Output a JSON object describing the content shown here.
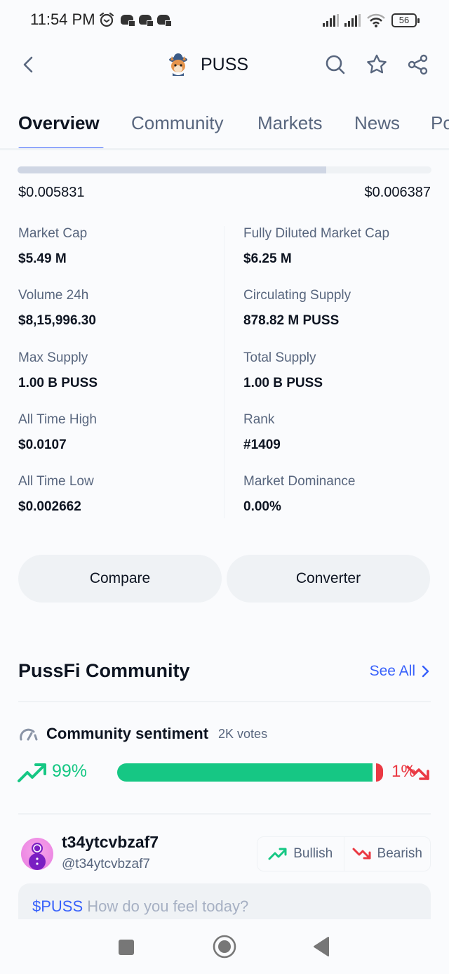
{
  "status_bar": {
    "time": "11:54 PM",
    "battery": "56",
    "icons": [
      "alarm-icon",
      "gamepad-icon",
      "gamepad-icon",
      "gamepad-icon",
      "signal-icon",
      "signal-icon",
      "wifi-icon",
      "battery-icon"
    ]
  },
  "header": {
    "coin_symbol": "PUSS",
    "icons": [
      "back-icon",
      "search-icon",
      "star-icon",
      "share-icon"
    ]
  },
  "tabs": [
    {
      "label": "Overview",
      "active": true
    },
    {
      "label": "Community",
      "active": false
    },
    {
      "label": "Markets",
      "active": false
    },
    {
      "label": "News",
      "active": false
    },
    {
      "label": "Po",
      "active": false
    }
  ],
  "price_range": {
    "low": "$0.005831",
    "high": "$0.006387",
    "position_fraction": 0.746
  },
  "stats": {
    "left": [
      {
        "label": "Market Cap",
        "value": "$5.49 M"
      },
      {
        "label": "Volume 24h",
        "value": "$8,15,996.30"
      },
      {
        "label": "Max Supply",
        "value": "1.00 B PUSS"
      },
      {
        "label": "All Time High",
        "value": "$0.0107"
      },
      {
        "label": "All Time Low",
        "value": "$0.002662"
      }
    ],
    "right": [
      {
        "label": "Fully Diluted Market Cap",
        "value": "$6.25 M"
      },
      {
        "label": "Circulating Supply",
        "value": "878.82 M PUSS"
      },
      {
        "label": "Total Supply",
        "value": "1.00 B PUSS"
      },
      {
        "label": "Rank",
        "value": "#1409"
      },
      {
        "label": "Market Dominance",
        "value": "0.00%"
      }
    ]
  },
  "actions": {
    "compare": "Compare",
    "converter": "Converter"
  },
  "community": {
    "title": "PussFi Community",
    "see_all": "See All",
    "sentiment_title": "Community sentiment",
    "votes": "2K votes",
    "bullish_pct": "99%",
    "bearish_pct": "1%",
    "bullish_fraction": 0.99
  },
  "user": {
    "name": "t34ytcvbzaf7",
    "handle": "@t34ytcvbzaf7",
    "bullish_label": "Bullish",
    "bearish_label": "Bearish"
  },
  "post_input": {
    "tag": "$PUSS",
    "placeholder": "How do you feel today?"
  },
  "colors": {
    "accent": "#3861fb",
    "bullish": "#16c784",
    "bearish": "#ea3943",
    "text_primary": "#0d1421",
    "text_secondary": "#58667e"
  },
  "nav_bar": [
    "recents-button",
    "home-button",
    "back-button"
  ]
}
